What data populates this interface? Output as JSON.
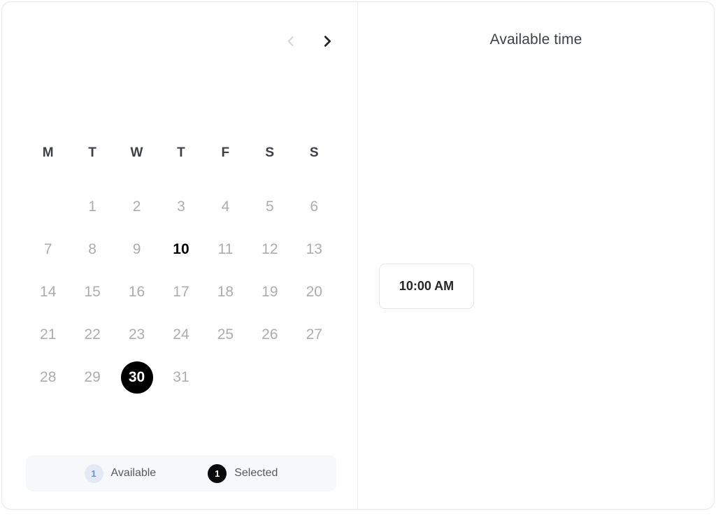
{
  "calendar": {
    "month_label": "",
    "prev_label": "Previous month",
    "next_label": "Next month",
    "weekdays": [
      "M",
      "T",
      "W",
      "T",
      "F",
      "S",
      "S"
    ],
    "leading_blanks": 1,
    "days": [
      1,
      2,
      3,
      4,
      5,
      6,
      7,
      8,
      9,
      10,
      11,
      12,
      13,
      14,
      15,
      16,
      17,
      18,
      19,
      20,
      21,
      22,
      23,
      24,
      25,
      26,
      27,
      28,
      29,
      30,
      31
    ],
    "today": 10,
    "selected": 30,
    "legend": [
      {
        "count": "1",
        "label": "Available",
        "state": "available"
      },
      {
        "count": "1",
        "label": "Selected",
        "state": "selected"
      }
    ]
  },
  "time_panel": {
    "title": "Available time",
    "subtitle": "",
    "slots": [
      {
        "time": "10:00 AM"
      }
    ]
  },
  "colors": {
    "selected_bg": "#000000",
    "today_text": "#000000",
    "day_text": "#adadad",
    "available_badge_bg": "#e3eaf6",
    "available_badge_text": "#6d8fd4",
    "selected_badge_bg": "#0a0a0a",
    "legend_bg": "#f7f8f9",
    "card_border": "#eaeaea",
    "nav_prev": "#d6d6d6",
    "nav_next": "#242424"
  }
}
